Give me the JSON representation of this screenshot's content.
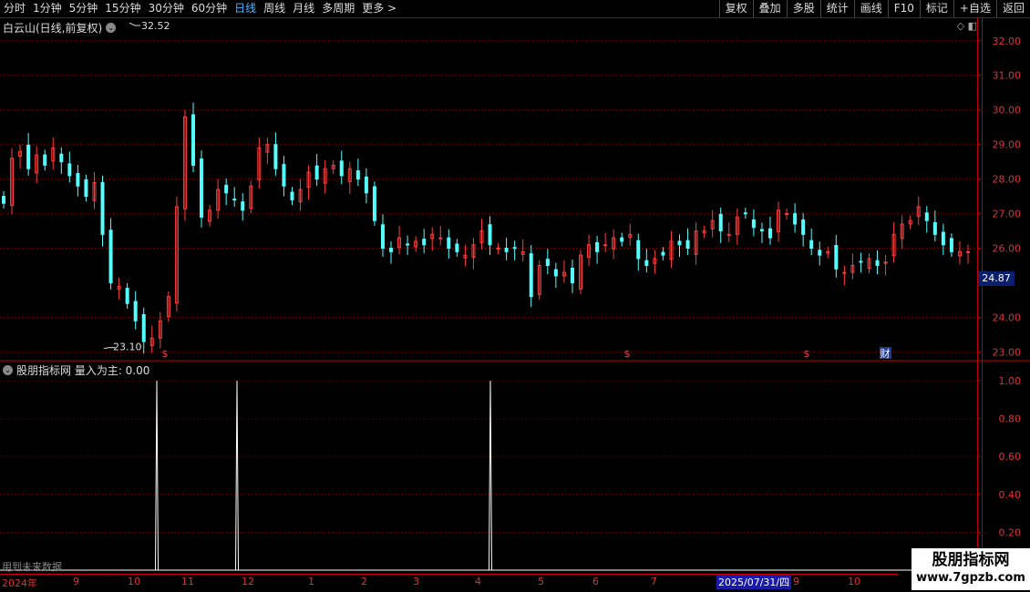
{
  "toolbar": {
    "period_tabs": [
      "分时",
      "1分钟",
      "5分钟",
      "15分钟",
      "30分钟",
      "60分钟",
      "日线",
      "周线",
      "月线",
      "多周期",
      "更多 >"
    ],
    "active_tab": "日线",
    "right_tools": [
      "复权",
      "叠加",
      "多股",
      "统计",
      "画线",
      "F10",
      "标记",
      "+自选",
      "返回"
    ]
  },
  "main_chart": {
    "title": "白云山(日线,前复权)",
    "y_ticks": [
      "32.00",
      "31.00",
      "30.00",
      "29.00",
      "28.00",
      "27.00",
      "26.00",
      "24.00",
      "23.00"
    ],
    "high_label": "32.52",
    "low_label": "23.10",
    "current_price": "24.87",
    "event_markers": [
      "$",
      "$",
      "$",
      "财"
    ]
  },
  "indicator": {
    "title": "股朋指标网 量入为主: 0.00",
    "y_ticks": [
      "1.00",
      "0.80",
      "0.60",
      "0.40",
      "0.20"
    ]
  },
  "footer": {
    "future_note": "用到未来数据",
    "date_labels": [
      "2024年",
      "9",
      "10",
      "11",
      "12",
      "1",
      "2",
      "3",
      "4",
      "5",
      "6",
      "7",
      "9",
      "10"
    ],
    "date_badge": "2025/07/31/四"
  },
  "watermark": {
    "line1": "股朋指标网",
    "line2": "www.7gpzb.com"
  },
  "colors": {
    "up": "#ff3c3c",
    "down": "#54ffff",
    "grid": "#7a0000",
    "axis": "#c00000",
    "signal": "#ffffff"
  },
  "chart_data": {
    "type": "candlestick",
    "ylim": [
      22.8,
      32.6
    ],
    "x_date_labels": [
      "2024年",
      "9",
      "10",
      "11",
      "12",
      "1",
      "2",
      "3",
      "4",
      "5",
      "6",
      "7",
      "9",
      "10"
    ],
    "close_path": [
      27.3,
      28.6,
      28.8,
      28.3,
      28.7,
      28.4,
      28.9,
      28.5,
      28.1,
      27.8,
      27.5,
      27.9,
      26.4,
      25.0,
      24.9,
      24.4,
      23.9,
      23.3,
      23.4,
      23.9,
      24.6,
      27.2,
      29.8,
      28.4,
      26.9,
      27.1,
      27.7,
      27.6,
      27.4,
      27.1,
      27.8,
      28.9,
      29.0,
      28.3,
      27.8,
      27.4,
      27.7,
      28.2,
      28.0,
      28.3,
      28.4,
      28.1,
      28.3,
      28.0,
      27.6,
      26.8,
      26.0,
      25.9,
      26.3,
      26.1,
      26.2,
      26.1,
      26.4,
      26.3,
      26.0,
      25.9,
      25.8,
      26.1,
      26.5,
      26.1,
      26.0,
      25.9,
      26.0,
      25.9,
      24.6,
      25.5,
      25.5,
      25.2,
      25.3,
      25.0,
      25.8,
      26.1,
      25.9,
      26.1,
      26.3,
      26.2,
      26.4,
      25.7,
      25.5,
      25.7,
      25.8,
      26.2,
      26.1,
      26.0,
      26.5,
      26.5,
      26.8,
      26.5,
      26.4,
      26.9,
      27.0,
      26.6,
      26.5,
      26.3,
      27.1,
      27.0,
      26.7,
      26.4,
      26.0,
      25.8,
      25.9,
      25.4,
      25.3,
      25.5,
      25.6,
      25.7,
      25.5,
      25.6,
      26.4,
      26.7,
      26.8,
      27.2,
      26.8,
      26.4,
      26.1,
      25.9,
      25.9,
      25.9
    ],
    "signal_x": [
      "10",
      "12",
      "4"
    ],
    "signal_value": 1.0
  }
}
